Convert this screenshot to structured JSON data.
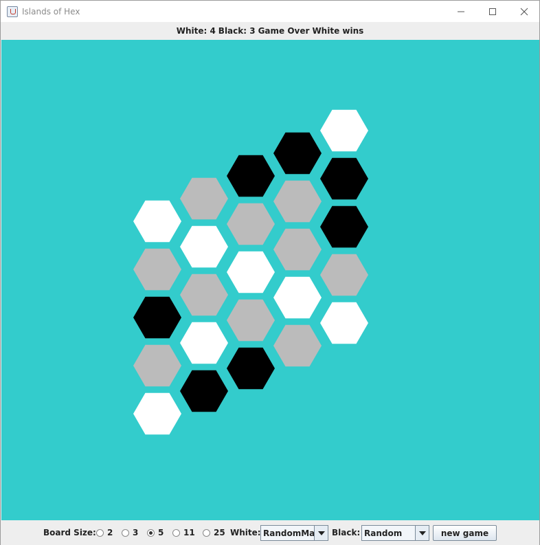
{
  "window": {
    "title": "Islands of Hex"
  },
  "status": {
    "white_score": "White: 4",
    "black_score": "Black: 3",
    "state": "Game Over",
    "result": "White wins"
  },
  "colors": {
    "board_bg": "#33cccc",
    "empty": "#bbbbbb",
    "white": "#ffffff",
    "black": "#000000"
  },
  "board": {
    "size": 5,
    "rows": [
      [
        "white",
        "empty",
        "black",
        "black",
        "white"
      ],
      [
        "empty",
        "white",
        "empty",
        "empty",
        "black"
      ],
      [
        "black",
        "empty",
        "white",
        "empty",
        "black"
      ],
      [
        "empty",
        "white",
        "empty",
        "white",
        "empty"
      ],
      [
        "white",
        "black",
        "black",
        "empty",
        "white"
      ]
    ]
  },
  "controls": {
    "board_size_label": "Board Size:",
    "sizes": [
      {
        "label": "2",
        "selected": false
      },
      {
        "label": "3",
        "selected": false
      },
      {
        "label": "5",
        "selected": true
      },
      {
        "label": "11",
        "selected": false
      },
      {
        "label": "25",
        "selected": false
      }
    ],
    "white_label": "White:",
    "white_player": "RandomMax",
    "black_label": "Black:",
    "black_player": "Random",
    "new_game_label": "new game"
  }
}
